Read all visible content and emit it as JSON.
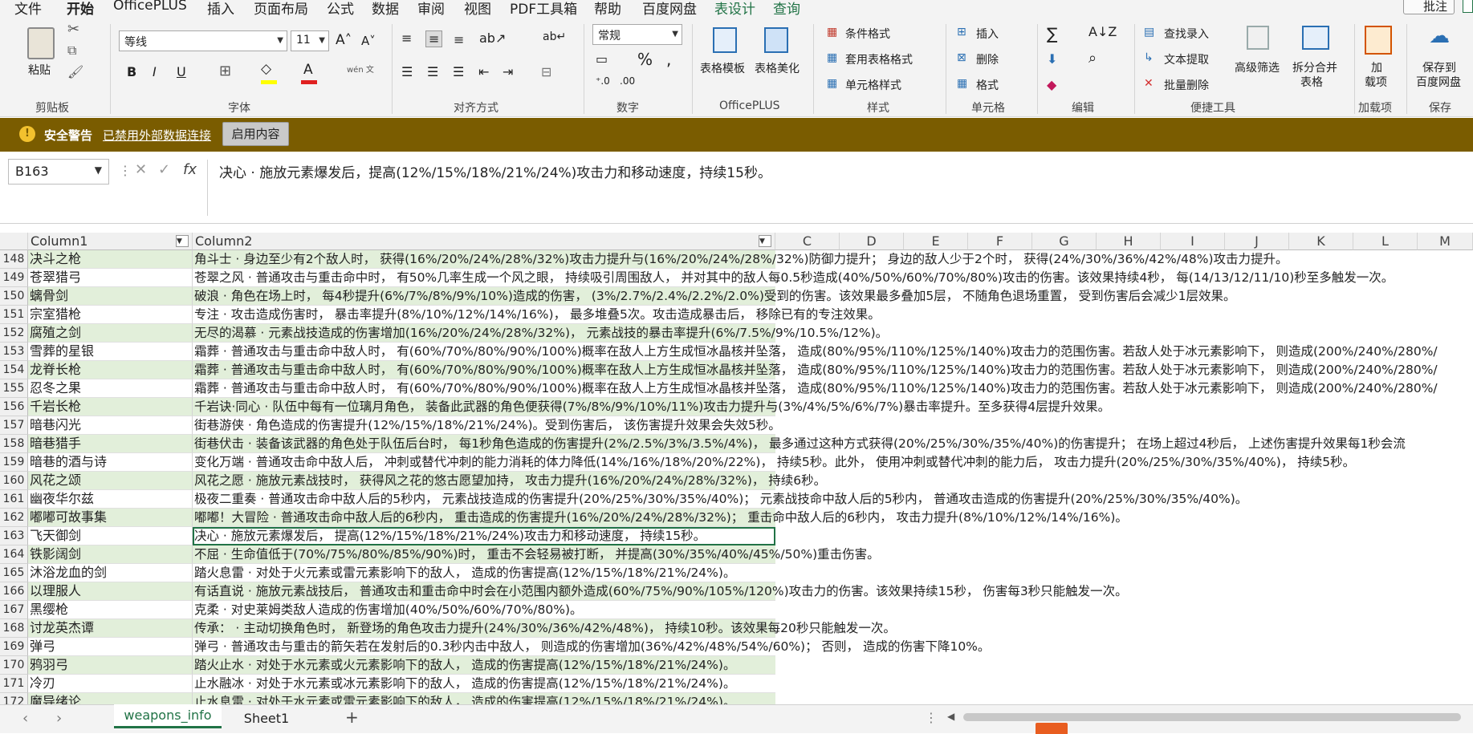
{
  "menu_tabs": [
    "文件",
    "开始",
    "OfficePLUS",
    "插入",
    "页面布局",
    "公式",
    "数据",
    "审阅",
    "视图",
    "PDF工具箱",
    "帮助",
    "百度网盘",
    "表设计",
    "查询"
  ],
  "comment_button": "批注",
  "ribbon": {
    "clipboard": {
      "paste": "粘贴",
      "label": "剪贴板"
    },
    "font": {
      "name": "等线",
      "size": "11",
      "label": "字体",
      "bold": "B",
      "italic": "I",
      "underline": "U",
      "font_color": "#e02020",
      "highlight_color": "#ffff00",
      "phonetic": "wén 文"
    },
    "alignment": {
      "label": "对齐方式"
    },
    "number": {
      "format": "常规",
      "label": "数字"
    },
    "officeplus": {
      "template": "表格模板",
      "beautify": "表格美化",
      "label": "OfficePLUS"
    },
    "styles": {
      "conditional": "条件格式",
      "table_format": "套用表格格式",
      "cell_style": "单元格样式",
      "label": "样式"
    },
    "cells": {
      "insert": "插入",
      "delete": "删除",
      "format": "格式",
      "label": "单元格"
    },
    "editing": {
      "label": "编辑"
    },
    "tools": {
      "lookup": "查找录入",
      "text_extract": "文本提取",
      "batch_delete": "批量删除",
      "advanced_filter": "高级筛选",
      "split_merge_1": "拆分合并",
      "split_merge_2": "表格",
      "label": "便捷工具"
    },
    "addins": {
      "load_1": "加",
      "load_2": "载项",
      "label": "加载项"
    },
    "save": {
      "save_1": "保存到",
      "save_2": "百度网盘",
      "label": "保存"
    }
  },
  "security": {
    "title": "安全警告",
    "message": "已禁用外部数据连接",
    "button": "启用内容"
  },
  "formula": {
    "namebox": "B163",
    "fx": "fx",
    "content": "决心 · 施放元素爆发后，提高(12%/15%/18%/21%/24%)攻击力和移动速度，持续15秒。"
  },
  "columns": {
    "col1": "Column1",
    "col2": "Column2",
    "others": [
      "C",
      "D",
      "E",
      "F",
      "G",
      "H",
      "I",
      "J",
      "K",
      "L",
      "M"
    ]
  },
  "rows": [
    {
      "n": "148",
      "a": "决斗之枪",
      "b": "角斗士 · 身边至少有2个敌人时， 获得(16%/20%/24%/28%/32%)攻击力提升与(16%/20%/24%/28%/32%)防御力提升； 身边的敌人少于2个时， 获得(24%/30%/36%/42%/48%)攻击力提升。"
    },
    {
      "n": "149",
      "a": "苍翠猎弓",
      "b": "苍翠之风 · 普通攻击与重击命中时， 有50%几率生成一个风之眼， 持续吸引周围敌人， 并对其中的敌人每0.5秒造成(40%/50%/60%/70%/80%)攻击的伤害。该效果持续4秒， 每(14/13/12/11/10)秒至多触发一次。"
    },
    {
      "n": "150",
      "a": "螭骨剑",
      "b": "破浪 · 角色在场上时， 每4秒提升(6%/7%/8%/9%/10%)造成的伤害， (3%/2.7%/2.4%/2.2%/2.0%)受到的伤害。该效果最多叠加5层， 不随角色退场重置， 受到伤害后会减少1层效果。"
    },
    {
      "n": "151",
      "a": "宗室猎枪",
      "b": "专注 · 攻击造成伤害时， 暴击率提升(8%/10%/12%/14%/16%)， 最多堆叠5次。攻击造成暴击后， 移除已有的专注效果。"
    },
    {
      "n": "152",
      "a": "腐殖之剑",
      "b": "无尽的渴慕 · 元素战技造成的伤害增加(16%/20%/24%/28%/32%)， 元素战技的暴击率提升(6%/7.5%/9%/10.5%/12%)。"
    },
    {
      "n": "153",
      "a": "雪葬的星银",
      "b": "霜葬 · 普通攻击与重击命中敌人时， 有(60%/70%/80%/90%/100%)概率在敌人上方生成恒冰晶核并坠落， 造成(80%/95%/110%/125%/140%)攻击力的范围伤害。若敌人处于冰元素影响下， 则造成(200%/240%/280%/"
    },
    {
      "n": "154",
      "a": "龙脊长枪",
      "b": "霜葬 · 普通攻击与重击命中敌人时， 有(60%/70%/80%/90%/100%)概率在敌人上方生成恒冰晶核并坠落， 造成(80%/95%/110%/125%/140%)攻击力的范围伤害。若敌人处于冰元素影响下， 则造成(200%/240%/280%/"
    },
    {
      "n": "155",
      "a": "忍冬之果",
      "b": "霜葬 · 普通攻击与重击命中敌人时， 有(60%/70%/80%/90%/100%)概率在敌人上方生成恒冰晶核并坠落， 造成(80%/95%/110%/125%/140%)攻击力的范围伤害。若敌人处于冰元素影响下， 则造成(200%/240%/280%/"
    },
    {
      "n": "156",
      "a": "千岩长枪",
      "b": "千岩诀·同心 · 队伍中每有一位璃月角色， 装备此武器的角色便获得(7%/8%/9%/10%/11%)攻击力提升与(3%/4%/5%/6%/7%)暴击率提升。至多获得4层提升效果。"
    },
    {
      "n": "157",
      "a": "暗巷闪光",
      "b": "街巷游侠 · 角色造成的伤害提升(12%/15%/18%/21%/24%)。受到伤害后， 该伤害提升效果会失效5秒。"
    },
    {
      "n": "158",
      "a": "暗巷猎手",
      "b": "街巷伏击 · 装备该武器的角色处于队伍后台时， 每1秒角色造成的伤害提升(2%/2.5%/3%/3.5%/4%)， 最多通过这种方式获得(20%/25%/30%/35%/40%)的伤害提升； 在场上超过4秒后， 上述伤害提升效果每1秒会流"
    },
    {
      "n": "159",
      "a": "暗巷的酒与诗",
      "b": "变化万端 · 普通攻击命中敌人后， 冲刺或替代冲刺的能力消耗的体力降低(14%/16%/18%/20%/22%)， 持续5秒。此外， 使用冲刺或替代冲刺的能力后， 攻击力提升(20%/25%/30%/35%/40%)， 持续5秒。"
    },
    {
      "n": "160",
      "a": "风花之颂",
      "b": "风花之愿 · 施放元素战技时， 获得风之花的悠古愿望加持， 攻击力提升(16%/20%/24%/28%/32%)， 持续6秒。"
    },
    {
      "n": "161",
      "a": "幽夜华尔兹",
      "b": "极夜二重奏 · 普通攻击命中敌人后的5秒内， 元素战技造成的伤害提升(20%/25%/30%/35%/40%)； 元素战技命中敌人后的5秒内， 普通攻击造成的伤害提升(20%/25%/30%/35%/40%)。"
    },
    {
      "n": "162",
      "a": "嘟嘟可故事集",
      "b": "嘟嘟！大冒险 · 普通攻击命中敌人后的6秒内， 重击造成的伤害提升(16%/20%/24%/28%/32%)； 重击命中敌人后的6秒内， 攻击力提升(8%/10%/12%/14%/16%)。"
    },
    {
      "n": "163",
      "a": "飞天御剑",
      "b": "决心 · 施放元素爆发后， 提高(12%/15%/18%/21%/24%)攻击力和移动速度， 持续15秒。"
    },
    {
      "n": "164",
      "a": "铁影阔剑",
      "b": "不屈 · 生命值低于(70%/75%/80%/85%/90%)时， 重击不会轻易被打断， 并提高(30%/35%/40%/45%/50%)重击伤害。"
    },
    {
      "n": "165",
      "a": "沐浴龙血的剑",
      "b": "踏火息雷 · 对处于火元素或雷元素影响下的敌人， 造成的伤害提高(12%/15%/18%/21%/24%)。"
    },
    {
      "n": "166",
      "a": "以理服人",
      "b": "有话直说 · 施放元素战技后， 普通攻击和重击命中时会在小范围内额外造成(60%/75%/90%/105%/120%)攻击力的伤害。该效果持续15秒， 伤害每3秒只能触发一次。"
    },
    {
      "n": "167",
      "a": "黑缨枪",
      "b": "克柔 · 对史莱姆类敌人造成的伤害增加(40%/50%/60%/70%/80%)。"
    },
    {
      "n": "168",
      "a": "讨龙英杰谭",
      "b": "传承： · 主动切换角色时， 新登场的角色攻击力提升(24%/30%/36%/42%/48%)， 持续10秒。该效果每20秒只能触发一次。"
    },
    {
      "n": "169",
      "a": "弹弓",
      "b": "弹弓 · 普通攻击与重击的箭矢若在发射后的0.3秒内击中敌人， 则造成的伤害增加(36%/42%/48%/54%/60%)； 否则， 造成的伤害下降10%。"
    },
    {
      "n": "170",
      "a": "鸦羽弓",
      "b": "踏火止水 · 对处于水元素或火元素影响下的敌人， 造成的伤害提高(12%/15%/18%/21%/24%)。"
    },
    {
      "n": "171",
      "a": "冷刃",
      "b": "止水融冰 · 对处于水元素或冰元素影响下的敌人， 造成的伤害提高(12%/15%/18%/21%/24%)。"
    },
    {
      "n": "172",
      "a": "魔导绪论",
      "b": "止水息雷 · 对处于水元素或雷元素影响下的敌人， 造成的伤害提高(12%/15%/18%/21%/24%)。"
    }
  ],
  "sheets": {
    "active": "weapons_info",
    "other": "Sheet1",
    "add": "+"
  },
  "colors": {
    "band": "#e2efda",
    "accent": "#217346",
    "security_bar": "#7a5c00"
  }
}
